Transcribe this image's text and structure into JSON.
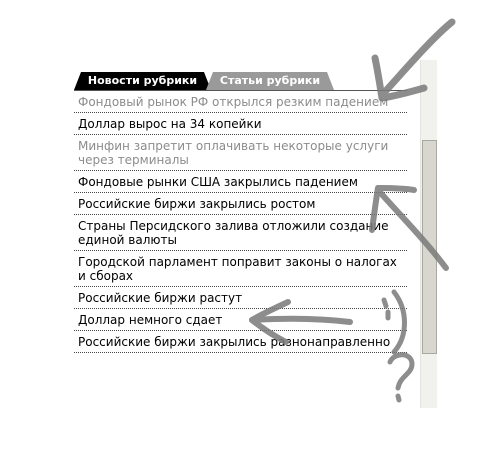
{
  "tabs": {
    "news_label": "Новости рубрики",
    "articles_label": "Статьи рубрики"
  },
  "items": [
    {
      "text": "Фондовый рынок РФ открылся резким падением",
      "state": "visited"
    },
    {
      "text": "Доллар вырос на 34 копейки",
      "state": "normal"
    },
    {
      "text": "Минфин запретит оплачивать некоторые услуги через терминалы",
      "state": "visited"
    },
    {
      "text": "Фондовые рынки США закрылись падением",
      "state": "normal"
    },
    {
      "text": "Российские биржи закрылись ростом",
      "state": "normal"
    },
    {
      "text": "Страны Персидского залива отложили создание единой валюты",
      "state": "normal"
    },
    {
      "text": "Городской парламент поправит законы о налогах и сборах",
      "state": "normal"
    },
    {
      "text": "Российские биржи растут",
      "state": "normal"
    },
    {
      "text": "Доллар немного сдает",
      "state": "normal"
    },
    {
      "text": "Российские биржи закрылись разнонаправленно",
      "state": "normal"
    }
  ],
  "annotations": {
    "smiley": ":-)",
    "question": "?"
  },
  "colors": {
    "active_tab": "#000000",
    "inactive_tab": "#9a9a9a",
    "visited_link": "#8c8c8c",
    "pencil": "#7a7a7a"
  }
}
